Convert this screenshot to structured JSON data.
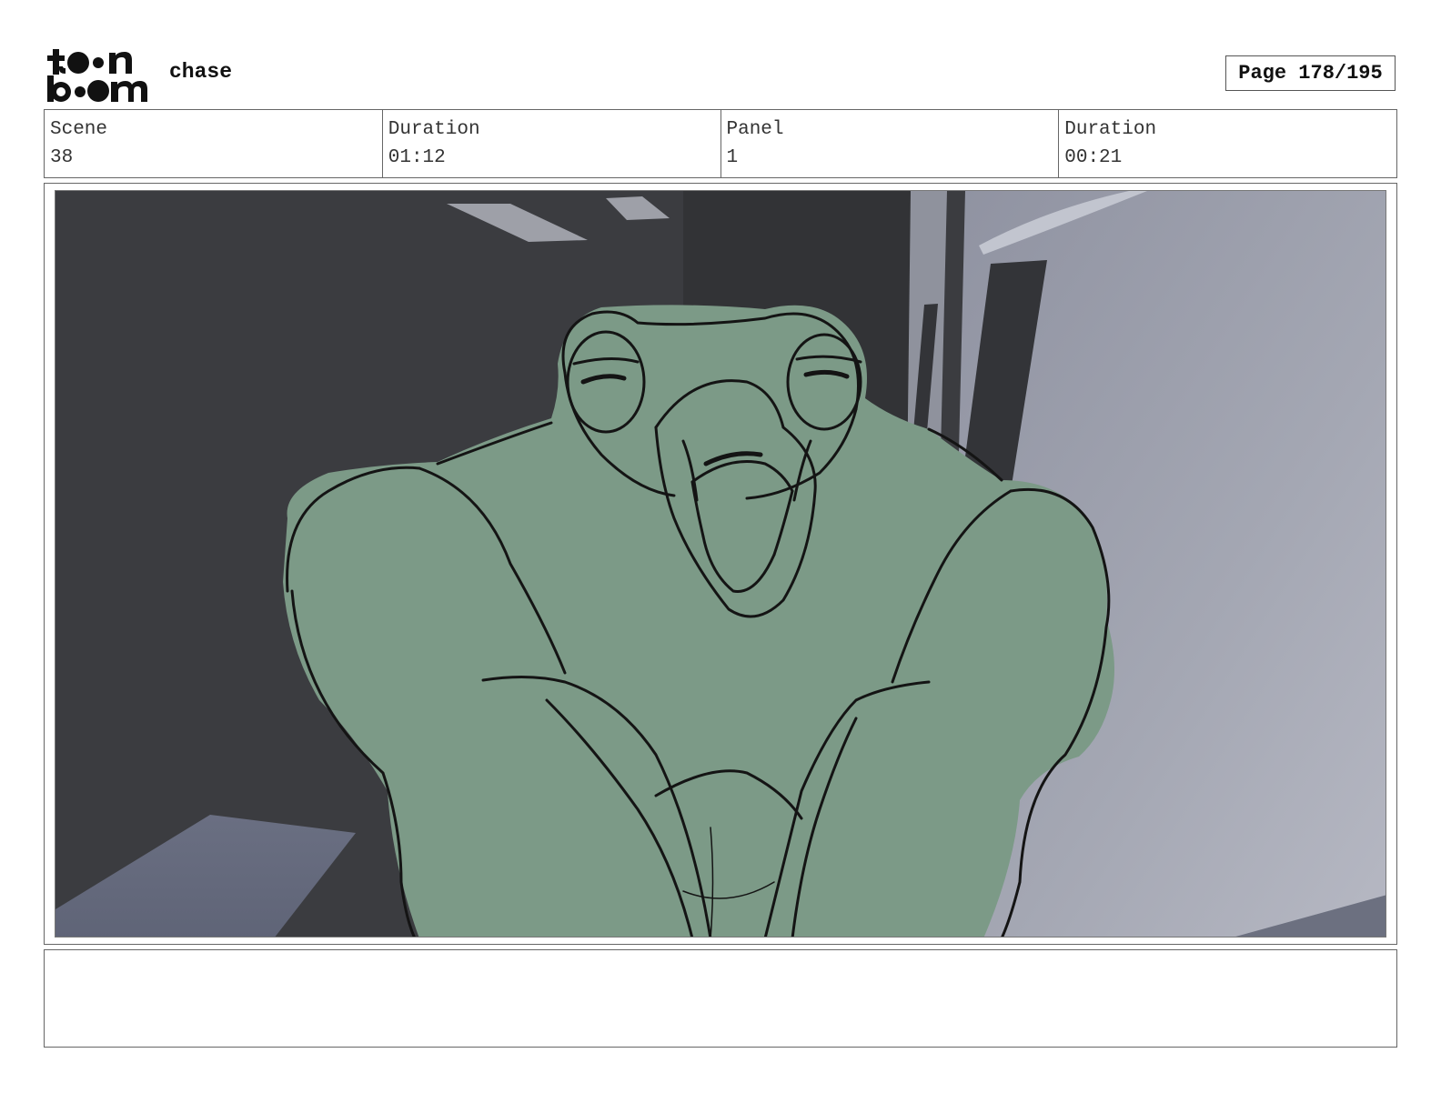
{
  "header": {
    "logo_line1": "toon",
    "logo_line2": "boom",
    "project_title": "chase",
    "page_label": "Page 178/195"
  },
  "info": {
    "scene_label": "Scene",
    "scene_value": "38",
    "scene_duration_label": "Duration",
    "scene_duration_value": "01:12",
    "panel_label": "Panel",
    "panel_value": "1",
    "panel_duration_label": "Duration",
    "panel_duration_value": "00:21"
  },
  "panel": {
    "character_fill": "#7c9a87",
    "background_dark": "#3b3c40",
    "background_light": "#9a9daa"
  },
  "notes": {
    "text": ""
  }
}
